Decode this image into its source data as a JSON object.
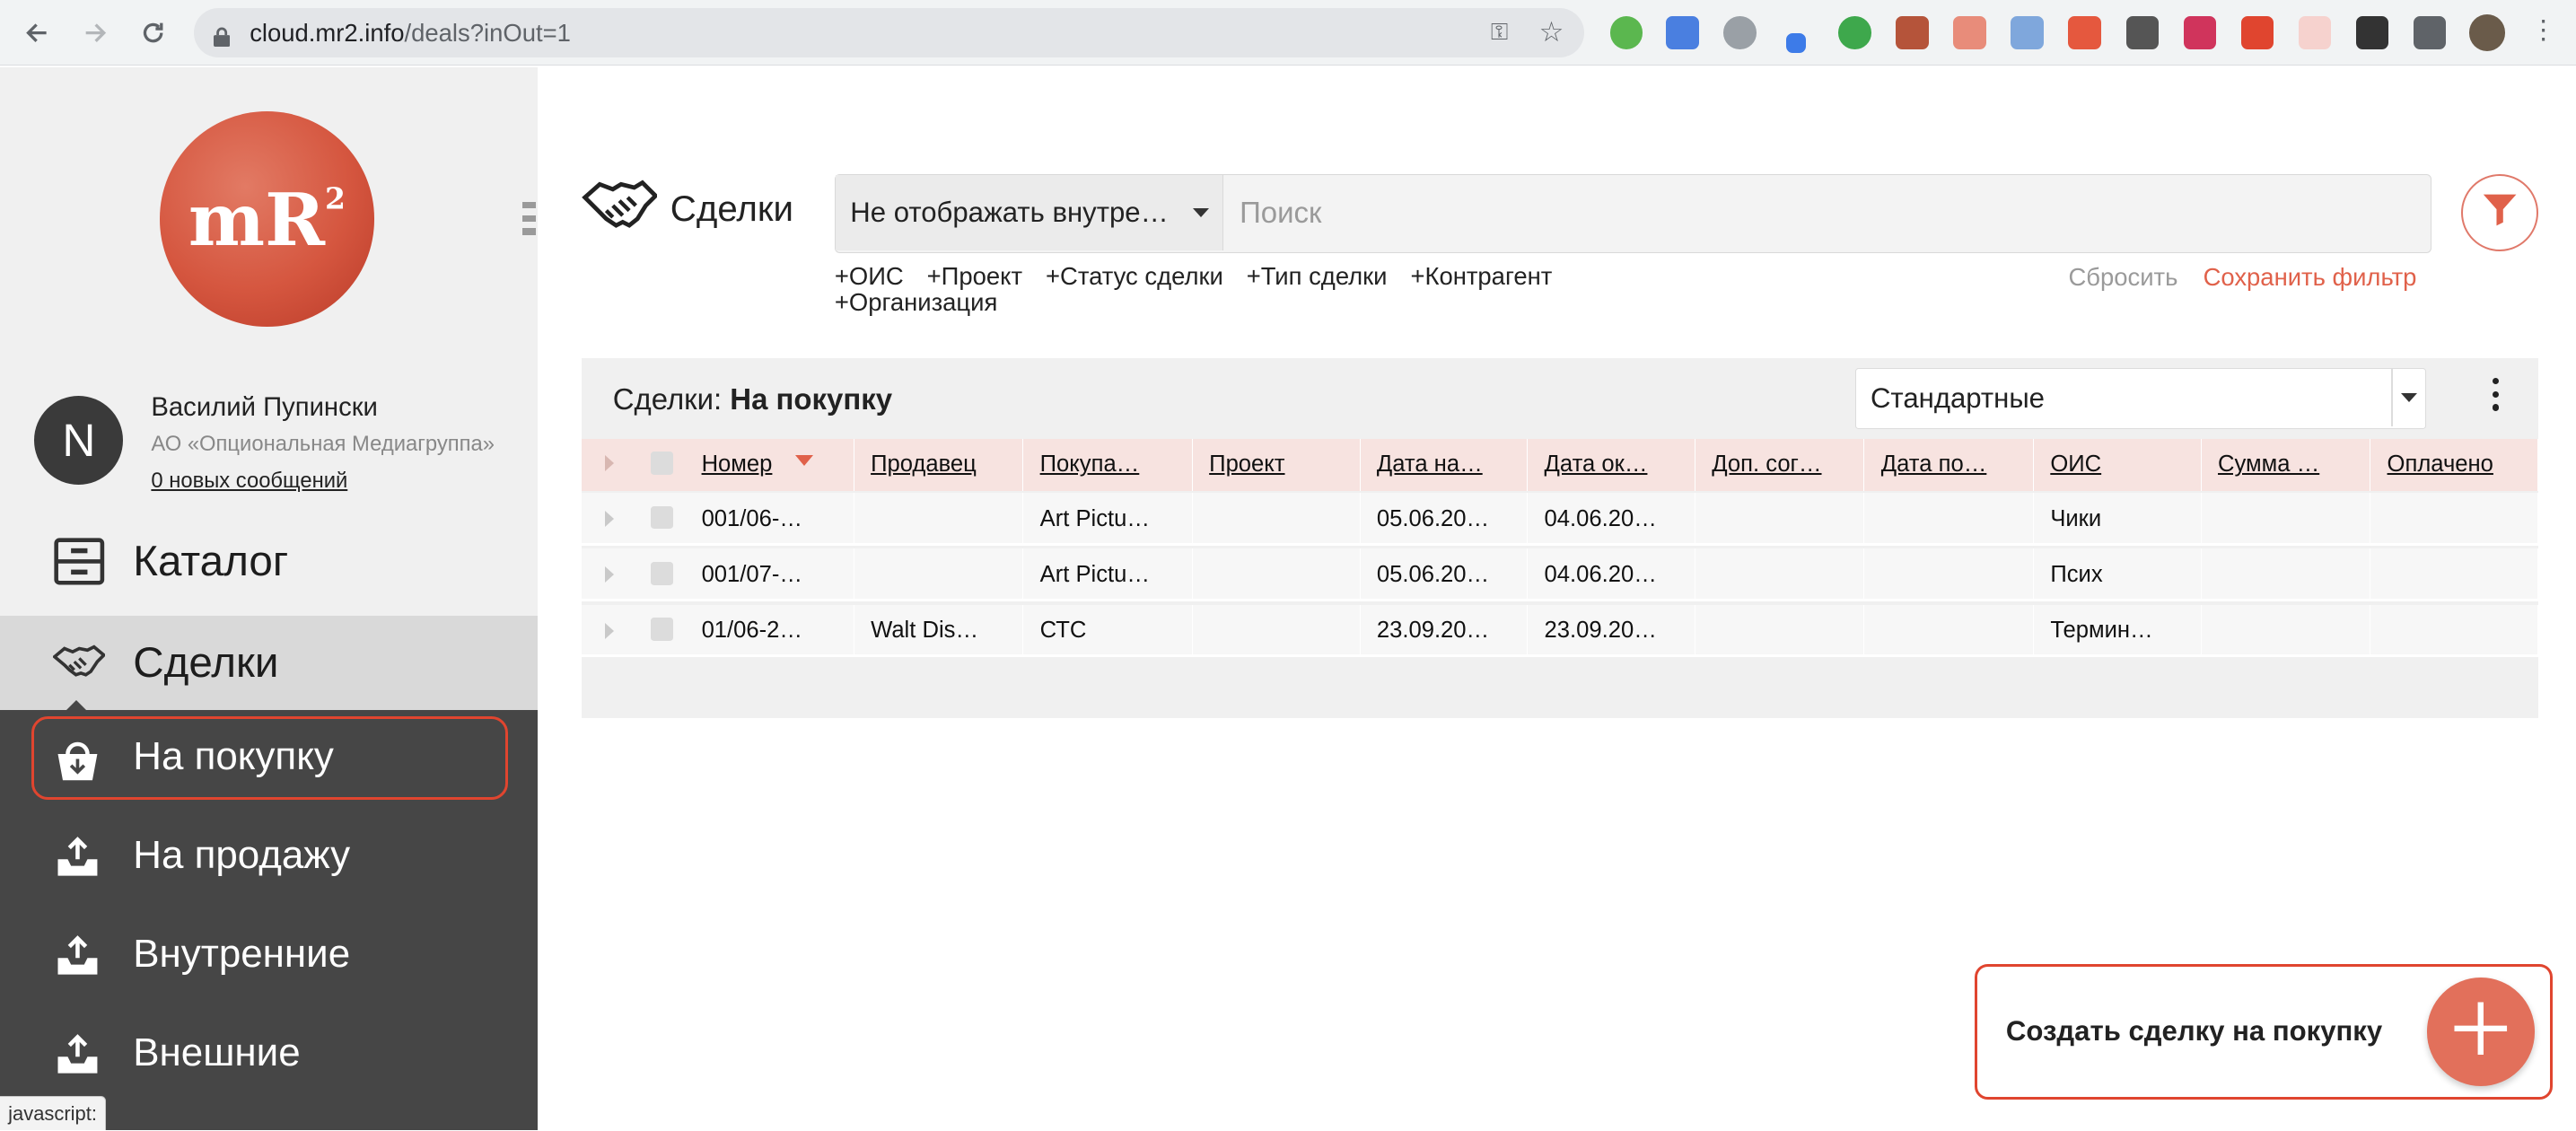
{
  "browser": {
    "url_host": "cloud.mr2.info",
    "url_path": "/deals?inOut=1",
    "status_bar_text": "javascript:"
  },
  "sidebar": {
    "logo_text": "mR",
    "logo_sup": "2",
    "user": {
      "initial": "N",
      "name": "Василий Пупински",
      "org": "АО «Опциональная Медиагруппа»",
      "messages": "0 новых сообщений"
    },
    "menu": {
      "catalog": "Каталог",
      "deals": "Сделки"
    },
    "submenu": {
      "buy": "На покупку",
      "sell": "На продажу",
      "internal": "Внутренние",
      "external": "Внешние"
    }
  },
  "header": {
    "title": "Сделки",
    "filter_select": "Не отображать внутре…",
    "search_placeholder": "Поиск",
    "chips": [
      "+ОИС",
      "+Проект",
      "+Статус сделки",
      "+Тип сделки",
      "+Контрагент",
      "+Организация"
    ],
    "reset": "Сбросить",
    "save_filter": "Сохранить фильтр"
  },
  "panel": {
    "title_prefix": "Сделки: ",
    "title_bold": "На покупку",
    "view_select": "Стандартные"
  },
  "table": {
    "columns": [
      "Номер",
      "Продавец",
      "Покупа…",
      "Проект",
      "Дата на…",
      "Дата ок…",
      "Доп. сог…",
      "Дата по…",
      "ОИС",
      "Сумма …",
      "Оплачено"
    ],
    "rows": [
      [
        "001/06-…",
        "",
        "Art Pictu…",
        "",
        "05.06.20…",
        "04.06.20…",
        "",
        "",
        "Чики",
        "",
        ""
      ],
      [
        "001/07-…",
        "",
        "Art Pictu…",
        "",
        "05.06.20…",
        "04.06.20…",
        "",
        "",
        "Псих",
        "",
        ""
      ],
      [
        "01/06-2…",
        "Walt Dis…",
        "СТС",
        "",
        "23.09.20…",
        "23.09.20…",
        "",
        "",
        "Термин…",
        "",
        ""
      ]
    ]
  },
  "fab": {
    "label": "Создать сделку на покупку"
  },
  "colors": {
    "accent": "#e0614a",
    "highlight_frame": "#e0452f",
    "sidebar_dark": "#464646",
    "table_header": "#f7e3e0"
  }
}
